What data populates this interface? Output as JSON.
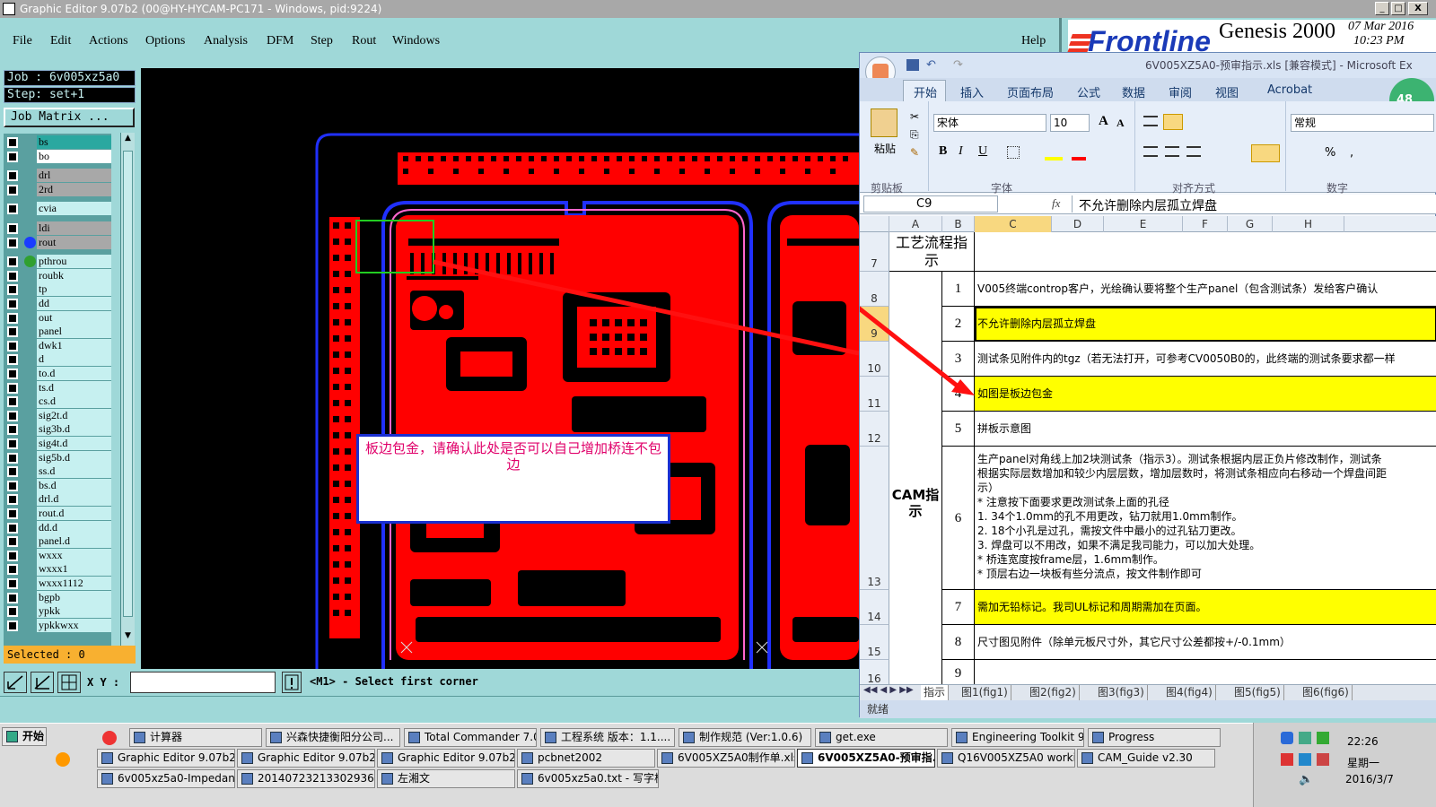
{
  "titlebar": {
    "title": "Graphic Editor 9.07b2 (00@HY-HYCAM-PC171 - Windows, pid:9224)",
    "min": "_",
    "max": "□",
    "close": "X"
  },
  "menubar": {
    "items": [
      "File",
      "Edit",
      "Actions",
      "Options",
      "Analysis",
      "DFM",
      "Step",
      "Rout",
      "Windows"
    ],
    "help": "Help"
  },
  "logo": {
    "brand": "Frontline",
    "product": "Genesis 2000",
    "date": "07 Mar 2016",
    "time": "10:23 PM"
  },
  "left": {
    "job": "Job  :  6v005xz5a0",
    "step": "Step:  set+1",
    "job_matrix": "Job Matrix ...",
    "selected": "Selected : 0"
  },
  "layers": [
    {
      "name": "bs",
      "color": "#2aa8a0"
    },
    {
      "name": "bo",
      "color": "#ffffff"
    },
    {
      "name": "drl",
      "color": "#a8a8a8"
    },
    {
      "name": "2rd",
      "color": "#a8a8a8"
    },
    {
      "name": "cvia",
      "color": "#c6f0f0"
    },
    {
      "name": "ldi",
      "color": "#a8a8a8"
    },
    {
      "name": "rout",
      "color": "#a8a8a8",
      "dot": "#1a3cff"
    },
    {
      "name": "pthrou",
      "color": "#c6f0f0",
      "dot": "#30a030"
    },
    {
      "name": "roubk",
      "color": "#c6f0f0"
    },
    {
      "name": "tp",
      "color": "#c6f0f0"
    },
    {
      "name": "dd",
      "color": "#c6f0f0"
    },
    {
      "name": "out",
      "color": "#c6f0f0"
    },
    {
      "name": "panel",
      "color": "#c6f0f0"
    },
    {
      "name": "dwk1",
      "color": "#c6f0f0"
    },
    {
      "name": "d",
      "color": "#c6f0f0"
    },
    {
      "name": "to.d",
      "color": "#c6f0f0"
    },
    {
      "name": "ts.d",
      "color": "#c6f0f0"
    },
    {
      "name": "cs.d",
      "color": "#c6f0f0"
    },
    {
      "name": "sig2t.d",
      "color": "#c6f0f0"
    },
    {
      "name": "sig3b.d",
      "color": "#c6f0f0"
    },
    {
      "name": "sig4t.d",
      "color": "#c6f0f0"
    },
    {
      "name": "sig5b.d",
      "color": "#c6f0f0"
    },
    {
      "name": "ss.d",
      "color": "#c6f0f0"
    },
    {
      "name": "bs.d",
      "color": "#c6f0f0"
    },
    {
      "name": "drl.d",
      "color": "#c6f0f0"
    },
    {
      "name": "rout.d",
      "color": "#c6f0f0"
    },
    {
      "name": "dd.d",
      "color": "#c6f0f0"
    },
    {
      "name": "panel.d",
      "color": "#c6f0f0"
    },
    {
      "name": "wxxx",
      "color": "#c6f0f0"
    },
    {
      "name": "wxxx1",
      "color": "#c6f0f0"
    },
    {
      "name": "wxxx1112",
      "color": "#c6f0f0"
    },
    {
      "name": "bgpb",
      "color": "#c6f0f0"
    },
    {
      "name": "ypkk",
      "color": "#c6f0f0"
    },
    {
      "name": "ypkkwxx",
      "color": "#c6f0f0"
    }
  ],
  "cmd": {
    "xy_label": "X Y :",
    "prompt": "<M1> - Select first corner"
  },
  "annotation": {
    "text": "板边包金，请确认此处是否可以自己增加桥连不包边"
  },
  "excel": {
    "title": "6V005XZ5A0-预审指示.xls  [兼容模式] - Microsoft Ex",
    "tabs": [
      "开始",
      "插入",
      "页面布局",
      "公式",
      "数据",
      "审阅",
      "视图",
      "Acrobat"
    ],
    "ribbon": {
      "paste": "粘贴",
      "clipboard": "剪贴板",
      "font_name": "宋体",
      "font_size": "10",
      "font_group": "字体",
      "align_group": "对齐方式",
      "number_format": "常规",
      "number_group": "数字",
      "bold": "B",
      "italic": "I",
      "underline": "U"
    },
    "namebox": "C9",
    "fx": "fx",
    "formula": "不允许删除内层孤立焊盘",
    "columns": [
      "A",
      "B",
      "C",
      "D",
      "E",
      "F",
      "G",
      "H"
    ],
    "header_cell": "工艺流程指示",
    "section_label": "CAM指示",
    "rows": [
      {
        "row": "7"
      },
      {
        "row": "8",
        "num": "1",
        "text": "V005终端controp客户，光绘确认要将整个生产panel（包含测试条）发给客户确认",
        "yellow": false
      },
      {
        "row": "9",
        "num": "2",
        "text": "不允许删除内层孤立焊盘",
        "yellow": true
      },
      {
        "row": "10",
        "num": "3",
        "text": "测试条见附件内的tgz（若无法打开，可参考CV0050B0的，此终端的测试条要求都一样",
        "yellow": false
      },
      {
        "row": "11",
        "num": "4",
        "text": "如图是板边包金",
        "yellow": true
      },
      {
        "row": "12",
        "num": "5",
        "text": "拼板示意图",
        "yellow": false
      },
      {
        "row": "13",
        "num": "6",
        "lines": [
          "生产panel对角线上加2块测试条（指示3）。测试条根据内层正负片修改制作，测试条",
          "根据实际层数增加和较少内层层数，增加层数时，将测试条相应向右移动一个焊盘间距",
          "示）",
          "* 注意按下面要求更改测试条上面的孔径",
          "1.   34个1.0mm的孔不用更改，钻刀就用1.0mm制作。",
          "2.   18个小孔是过孔，需按文件中最小的过孔钻刀更改。",
          "3.   焊盘可以不用改，如果不满足我司能力，可以加大处理。",
          "* 桥连宽度按frame层，1.6mm制作。",
          "* 顶层右边一块板有些分流点，按文件制作即可"
        ],
        "yellow": false
      },
      {
        "row": "14",
        "num": "7",
        "text": "需加无铅标记。我司UL标记和周期需加在页面。",
        "yellow": true
      },
      {
        "row": "15",
        "num": "8",
        "text": "尺寸图见附件（除单元板尺寸外，其它尺寸公差都按+/-0.1mm）",
        "yellow": false
      },
      {
        "row": "16",
        "num": "9",
        "text": "",
        "yellow": false
      }
    ],
    "sheet_tabs": [
      "指示",
      "图1(fig1)",
      "图2(fig2)",
      "图3(fig3)",
      "图4(fig4)",
      "图5(fig5)",
      "图6(fig6)"
    ],
    "status": "就绪"
  },
  "taskbar": {
    "start": "开始",
    "row1": [
      "计算器",
      "兴森快捷衡阳分公司...",
      "Total Commander 7.0 p...",
      "工程系统  版本：1.1....",
      "制作规范 (Ver:1.0.6)",
      "get.exe",
      "Engineering Toolkit 9.0...",
      "Progress"
    ],
    "row2": [
      "Graphic Editor 9.07b2 (0...",
      "Graphic Editor 9.07b2 (0...",
      "Graphic Editor 9.07b2 (0...",
      "pcbnet2002",
      "6V005XZ5A0制作单.xls ...",
      "6V005XZ5A0-预审指...",
      "Q16V005XZ5A0 working ...",
      "CAM_Guide v2.30"
    ],
    "row3": [
      "6v005xz5a0-Impedance ...",
      "20140723213302936.rtf...",
      "左湘文",
      "6v005xz5a0.txt - 写字板"
    ],
    "time": "22:26",
    "weekday": "星期一",
    "date": "2016/3/7"
  }
}
